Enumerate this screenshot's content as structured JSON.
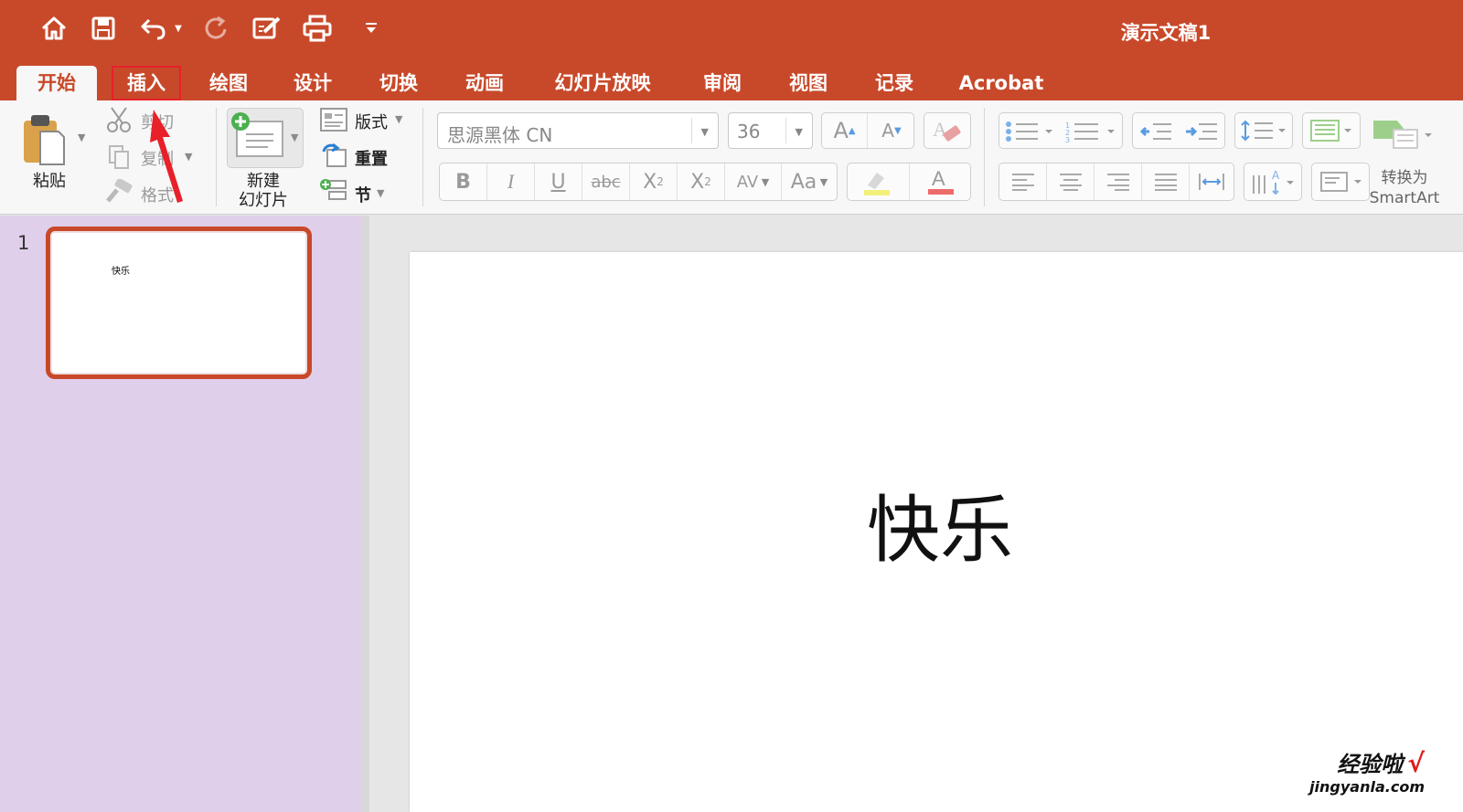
{
  "app": {
    "document_title": "演示文稿1"
  },
  "tabs": [
    {
      "label": "开始",
      "active": true
    },
    {
      "label": "插入",
      "highlighted": true
    },
    {
      "label": "绘图"
    },
    {
      "label": "设计"
    },
    {
      "label": "切换"
    },
    {
      "label": "动画"
    },
    {
      "label": "幻灯片放映"
    },
    {
      "label": "审阅"
    },
    {
      "label": "视图"
    },
    {
      "label": "记录"
    },
    {
      "label": "Acrobat"
    }
  ],
  "ribbon": {
    "paste_label": "粘贴",
    "cut_label": "剪切",
    "copy_label": "复制",
    "format_label": "格式",
    "new_slide_label_1": "新建",
    "new_slide_label_2": "幻灯片",
    "layout_label": "版式",
    "reset_label": "重置",
    "section_label": "节",
    "font_name": "思源黑体 CN",
    "font_size": "36",
    "convert_label_1": "转换为",
    "convert_label_2": "SmartArt"
  },
  "slides_pane": {
    "slide_number": "1",
    "thumb_text": "快乐"
  },
  "slide": {
    "text": "快乐"
  },
  "watermark": {
    "text": "经验啦",
    "check": "√",
    "url": "jingyanla.com"
  },
  "colors": {
    "brand": "#c8492a",
    "thumb_pane": "#e0cfea",
    "annotation": "#e8202a"
  }
}
